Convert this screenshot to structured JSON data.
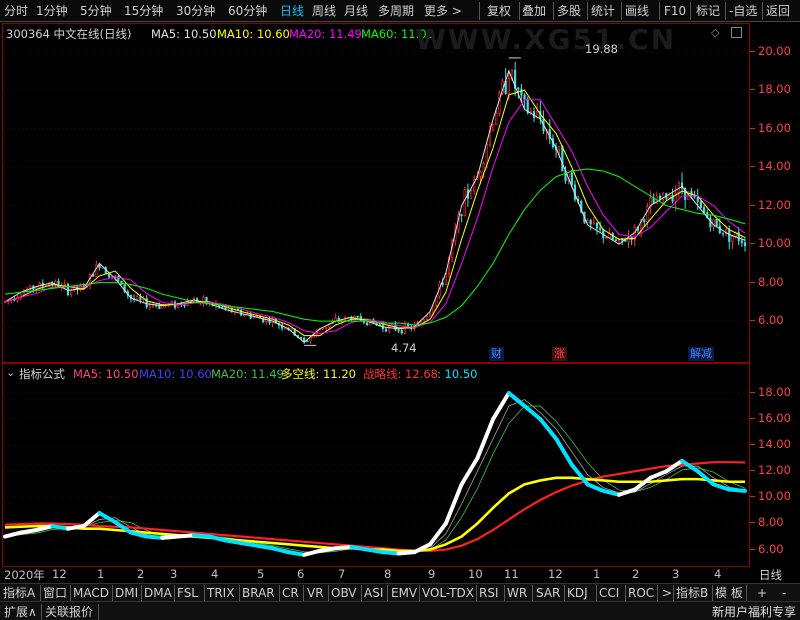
{
  "toolbar": {
    "periods": [
      {
        "label": "分时",
        "active": false
      },
      {
        "label": "1分钟",
        "active": false
      },
      {
        "label": "5分钟",
        "active": false
      },
      {
        "label": "15分钟",
        "active": false
      },
      {
        "label": "30分钟",
        "active": false
      },
      {
        "label": "60分钟",
        "active": false
      },
      {
        "label": "日线",
        "active": true
      },
      {
        "label": "周线",
        "active": false
      },
      {
        "label": "月线",
        "active": false
      },
      {
        "label": "多周期",
        "active": false
      },
      {
        "label": "更多 >",
        "active": false
      }
    ],
    "right_buttons": [
      "复权",
      "叠加",
      "多股",
      "统计",
      "画线",
      "F10",
      "标记",
      "-自选",
      "返回"
    ]
  },
  "main_chart": {
    "stock_title": "300364 中文在线(日线)",
    "ma_legend": [
      {
        "label": "MA5: 10.50",
        "color": "#e0e0e0"
      },
      {
        "label": "MA10: 10.60",
        "color": "#ffff00"
      },
      {
        "label": "MA20: 11.49",
        "color": "#ff00ff"
      },
      {
        "label": "MA60: 11.06",
        "color": "#00ff00"
      }
    ],
    "y_axis": [
      "20.00",
      "18.00",
      "16.00",
      "14.00",
      "12.00",
      "10.00",
      "8.00",
      "6.00"
    ],
    "high_mark": "19.88",
    "low_mark": "4.74",
    "watermark": "WWW.XG51.CN",
    "markers": [
      {
        "label": "财",
        "color": "#4080ff"
      },
      {
        "label": "涨",
        "color": "#ff4040"
      },
      {
        "label": "解减",
        "color": "#4080ff"
      }
    ],
    "corner_icons": [
      "diamond-icon",
      "maximize-icon"
    ]
  },
  "sub_chart": {
    "title": "指标公式",
    "legend": [
      {
        "label": "MA5: 10.50",
        "color": "#ff4080"
      },
      {
        "label": "MA10: 10.60",
        "color": "#4040ff"
      },
      {
        "label": "MA20: 11.49",
        "color": "#40c040"
      },
      {
        "label": "多空线: 11.20",
        "color": "#ffff00"
      },
      {
        "label": "战略线: 12.68",
        "color": "#ff3030"
      },
      {
        "label": ": 10.50",
        "color": "#00e0ff"
      }
    ],
    "y_axis": [
      "18.00",
      "16.00",
      "14.00",
      "12.00",
      "10.00",
      "8.00",
      "6.00"
    ]
  },
  "date_bar": {
    "labels": [
      "2020年",
      "12",
      "1",
      "2",
      "3",
      "4",
      "5",
      "6",
      "7",
      "8",
      "9",
      "10",
      "11",
      "12",
      "1",
      "2",
      "3",
      "4"
    ],
    "period": "日线"
  },
  "indicator_tabs": [
    "指标A",
    "窗口",
    "MACD",
    "DMI",
    "DMA",
    "FSL",
    "TRIX",
    "BRAR",
    "CR",
    "VR",
    "OBV",
    "ASI",
    "EMV",
    "VOL-TDX",
    "RSI",
    "WR",
    "SAR",
    "KDJ",
    "CCI",
    "ROC",
    ">",
    "指标B",
    "模 板",
    "+",
    "-"
  ],
  "status_bar": {
    "left": [
      "扩展∧",
      "关联报价"
    ],
    "right": "新用户福利专享"
  },
  "chart_data": {
    "type": "line",
    "main": {
      "ylim": [
        4.5,
        20.5
      ],
      "note_series": [
        "close",
        "MA5",
        "MA10",
        "MA20",
        "MA60"
      ],
      "x_index": [
        0,
        10,
        20,
        30,
        40,
        50,
        60,
        70,
        80,
        90,
        100,
        110,
        120,
        130,
        140,
        150,
        160,
        170,
        180,
        190,
        200,
        210,
        220,
        230,
        240,
        250,
        260,
        270,
        280,
        290,
        300,
        310,
        320,
        330,
        340,
        350,
        360,
        370,
        380,
        390,
        400,
        410,
        420,
        430,
        440,
        450,
        460,
        470
      ],
      "close": [
        7.0,
        7.5,
        7.8,
        8.0,
        7.6,
        7.7,
        9.0,
        8.2,
        7.2,
        6.9,
        6.8,
        6.9,
        7.1,
        6.9,
        6.6,
        6.4,
        6.2,
        6.0,
        5.6,
        4.9,
        5.6,
        6.0,
        6.2,
        6.0,
        5.7,
        5.6,
        5.7,
        6.5,
        8.5,
        12.0,
        13.5,
        16.5,
        19.0,
        17.0,
        16.5,
        15.0,
        13.0,
        11.0,
        10.5,
        10.0,
        10.6,
        12.0,
        12.5,
        13.0,
        12.0,
        11.0,
        10.5,
        10.2
      ],
      "ma60": [
        7.4,
        7.5,
        7.6,
        7.7,
        7.8,
        7.9,
        8.0,
        8.0,
        7.9,
        7.7,
        7.4,
        7.2,
        7.0,
        6.9,
        6.8,
        6.7,
        6.6,
        6.5,
        6.3,
        6.1,
        6.0,
        6.0,
        6.0,
        6.0,
        5.9,
        5.9,
        5.8,
        5.9,
        6.2,
        6.8,
        7.8,
        9.0,
        10.5,
        11.8,
        12.8,
        13.5,
        13.8,
        13.9,
        13.8,
        13.5,
        13.0,
        12.5,
        12.0,
        11.8,
        11.6,
        11.5,
        11.3,
        11.06
      ]
    },
    "sub": {
      "ylim": [
        5.2,
        19.0
      ],
      "x_index": [
        0,
        10,
        20,
        30,
        40,
        50,
        60,
        70,
        80,
        90,
        100,
        110,
        120,
        130,
        140,
        150,
        160,
        170,
        180,
        190,
        200,
        210,
        220,
        230,
        240,
        250,
        260,
        270,
        280,
        290,
        300,
        310,
        320,
        330,
        340,
        350,
        360,
        370,
        380,
        390,
        400,
        410,
        420,
        430,
        440,
        450,
        460,
        470
      ],
      "cyan_white": [
        7.0,
        7.3,
        7.5,
        7.8,
        7.6,
        7.8,
        8.8,
        8.1,
        7.3,
        7.0,
        6.9,
        7.0,
        7.1,
        7.0,
        6.7,
        6.5,
        6.3,
        6.1,
        5.8,
        5.6,
        5.9,
        6.1,
        6.2,
        6.0,
        5.8,
        5.7,
        5.8,
        6.4,
        8.0,
        11.0,
        13.0,
        16.0,
        18.0,
        17.0,
        16.0,
        14.5,
        12.5,
        11.0,
        10.5,
        10.2,
        10.6,
        11.5,
        12.0,
        12.8,
        12.0,
        11.0,
        10.6,
        10.5
      ],
      "duokong_yellow": [
        7.7,
        7.75,
        7.8,
        7.8,
        7.7,
        7.6,
        7.6,
        7.5,
        7.4,
        7.3,
        7.2,
        7.1,
        7.0,
        6.9,
        6.8,
        6.7,
        6.6,
        6.5,
        6.4,
        6.3,
        6.2,
        6.1,
        6.1,
        6.0,
        6.0,
        5.9,
        5.9,
        6.0,
        6.4,
        7.0,
        8.0,
        9.2,
        10.3,
        11.0,
        11.3,
        11.5,
        11.5,
        11.4,
        11.3,
        11.2,
        11.2,
        11.2,
        11.3,
        11.4,
        11.4,
        11.3,
        11.2,
        11.2
      ],
      "zhanlue_red": [
        7.9,
        7.95,
        8.0,
        8.0,
        7.95,
        7.9,
        7.8,
        7.75,
        7.7,
        7.6,
        7.5,
        7.4,
        7.3,
        7.2,
        7.1,
        7.0,
        6.9,
        6.8,
        6.7,
        6.6,
        6.5,
        6.4,
        6.3,
        6.2,
        6.1,
        6.0,
        5.9,
        5.9,
        6.0,
        6.3,
        6.8,
        7.5,
        8.3,
        9.1,
        9.8,
        10.4,
        10.9,
        11.3,
        11.6,
        11.8,
        12.0,
        12.2,
        12.4,
        12.5,
        12.6,
        12.7,
        12.7,
        12.68
      ]
    }
  }
}
